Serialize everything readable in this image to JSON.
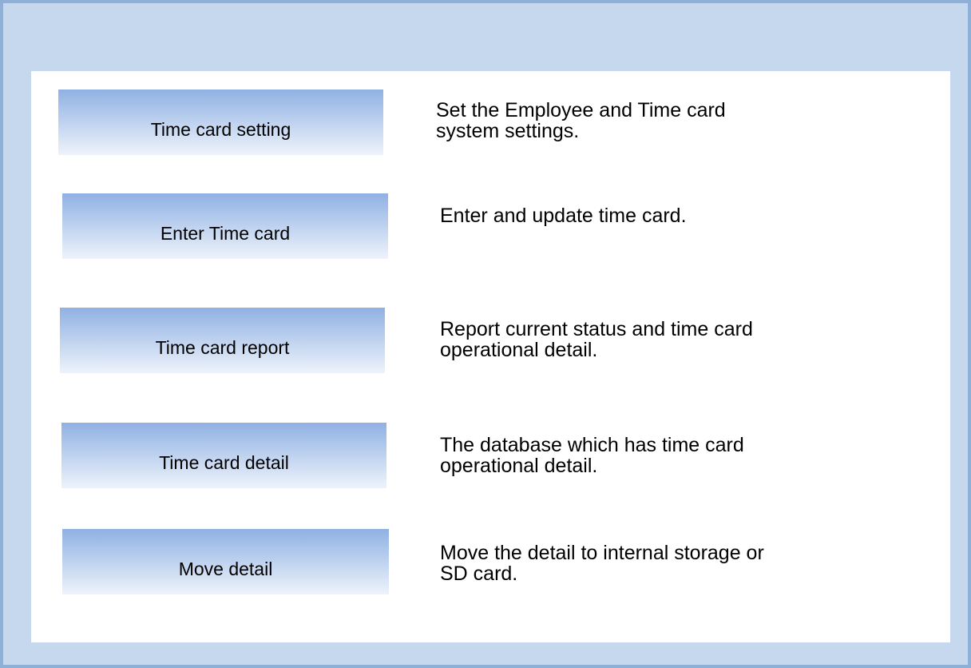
{
  "theme": {
    "frame_color": "#c5d8ee",
    "frame_border_color": "#8fb0d6",
    "panel_color": "#ffffff",
    "button_gradient_top": "#8fb1e3",
    "button_gradient_bottom": "#eef3fb"
  },
  "menu": {
    "items": [
      {
        "label": "Time card setting",
        "description": "Set the Employee and Time card system settings."
      },
      {
        "label": "Enter Time card",
        "description": "Enter and update time card."
      },
      {
        "label": "Time card report",
        "description": "Report current status and time card operational detail."
      },
      {
        "label": "Time card detail",
        "description": "The database which has time card operational detail."
      },
      {
        "label": "Move detail",
        "description": "Move the detail to internal storage or SD card."
      }
    ]
  }
}
